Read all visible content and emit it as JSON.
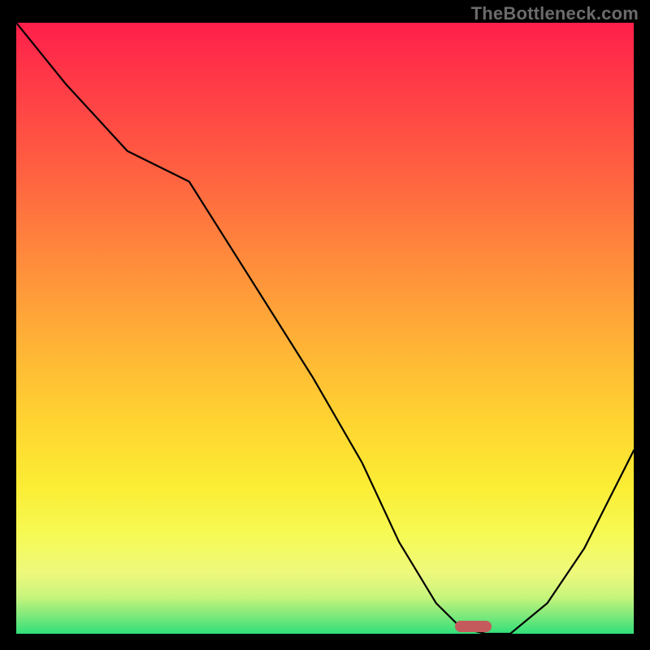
{
  "watermark": "TheBottleneck.com",
  "colors": {
    "frame_bg": "#000000",
    "marker": "#c55a5c",
    "curve": "#000000",
    "gradient_top": "#ff1f4b",
    "gradient_bottom": "#30df79"
  },
  "chart_data": {
    "type": "line",
    "title": "",
    "xlabel": "",
    "ylabel": "",
    "xlim": [
      0,
      100
    ],
    "ylim": [
      0,
      100
    ],
    "grid": false,
    "legend": false,
    "series": [
      {
        "name": "bottleneck-curve",
        "x": [
          0,
          8,
          18,
          28,
          38,
          48,
          56,
          62,
          68,
          72,
          76,
          80,
          86,
          92,
          100
        ],
        "values": [
          100,
          90,
          79,
          74,
          58,
          42,
          28,
          15,
          5,
          1,
          0,
          0,
          5,
          14,
          30
        ]
      }
    ],
    "marker": {
      "x_center": 74,
      "y": 0,
      "width_pct": 6
    },
    "gradient_stops": [
      {
        "pct": 0,
        "color": "#ff1f4b"
      },
      {
        "pct": 10,
        "color": "#ff3b47"
      },
      {
        "pct": 22,
        "color": "#ff5a42"
      },
      {
        "pct": 33,
        "color": "#ff7a3e"
      },
      {
        "pct": 44,
        "color": "#ff9a3a"
      },
      {
        "pct": 55,
        "color": "#ffb935"
      },
      {
        "pct": 66,
        "color": "#ffd631"
      },
      {
        "pct": 76,
        "color": "#fbed34"
      },
      {
        "pct": 84,
        "color": "#f6fa55"
      },
      {
        "pct": 90,
        "color": "#eef97c"
      },
      {
        "pct": 94,
        "color": "#c7f47c"
      },
      {
        "pct": 97,
        "color": "#7fe97b"
      },
      {
        "pct": 100,
        "color": "#30df79"
      }
    ]
  }
}
